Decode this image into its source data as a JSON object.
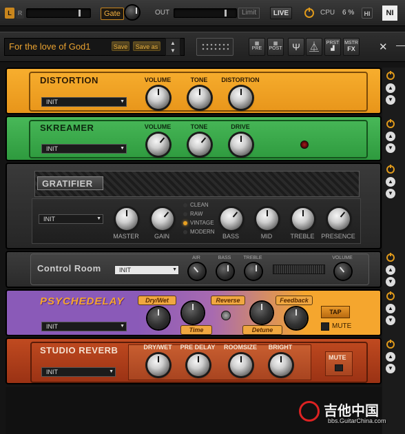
{
  "topbar": {
    "l_label": "L",
    "r_label": "R",
    "gate_label": "Gate",
    "out_label": "OUT",
    "limit_label": "Limit",
    "live_label": "LIVE",
    "cpu_label": "CPU",
    "cpu_value": "6 %",
    "hi_label": "HI",
    "logo_label": "NI"
  },
  "presetbar": {
    "preset_name": "For the love of God1",
    "save_label": "Save",
    "save_as_label": "Save as",
    "pre_label": "PRE",
    "post_label": "POST",
    "prst_label": "PRST",
    "mstr_label": "MSTR",
    "fx_label": "FX"
  },
  "modules": {
    "distortion": {
      "title": "DISTORTION",
      "preset": "INIT",
      "knobs": [
        "VOLUME",
        "TONE",
        "DISTORTION"
      ]
    },
    "skreamer": {
      "title": "SKREAMER",
      "preset": "INIT",
      "knobs": [
        "VOLUME",
        "TONE",
        "DRIVE"
      ]
    },
    "gratifier": {
      "title": "GRATIFIER",
      "preset": "INIT",
      "knobs": [
        "MASTER",
        "GAIN",
        "BASS",
        "MID",
        "TREBLE",
        "PRESENCE"
      ],
      "modes": [
        "CLEAN",
        "RAW",
        "VINTAGE",
        "MODERN"
      ],
      "active_mode": "VINTAGE"
    },
    "control_room": {
      "title": "Control Room",
      "preset": "INIT",
      "knobs": [
        "AIR",
        "BASS",
        "TREBLE",
        "VOLUME"
      ]
    },
    "psychedelay": {
      "title": "PSYCHEDELAY",
      "preset": "INIT",
      "tags": [
        "Dry/Wet",
        "Time",
        "Reverse",
        "Detune",
        "Feedback"
      ],
      "tap_label": "TAP",
      "mute_label": "MUTE"
    },
    "studio_reverb": {
      "title": "STUDIO REVERB",
      "preset": "INIT",
      "knobs": [
        "DRY/WET",
        "PRE DELAY",
        "ROOMSIZE",
        "BRIGHT"
      ],
      "mute_label": "MUTE"
    }
  },
  "watermark": {
    "cn": "吉他中国",
    "url": "bbs.GuitarChina.com"
  },
  "colors": {
    "orange_module": "#f5a623",
    "green_module": "#3aa84a",
    "psychedelay_purple": "#8a5ab8",
    "reverb_red": "#b8401c",
    "accent": "#e09a1b"
  }
}
